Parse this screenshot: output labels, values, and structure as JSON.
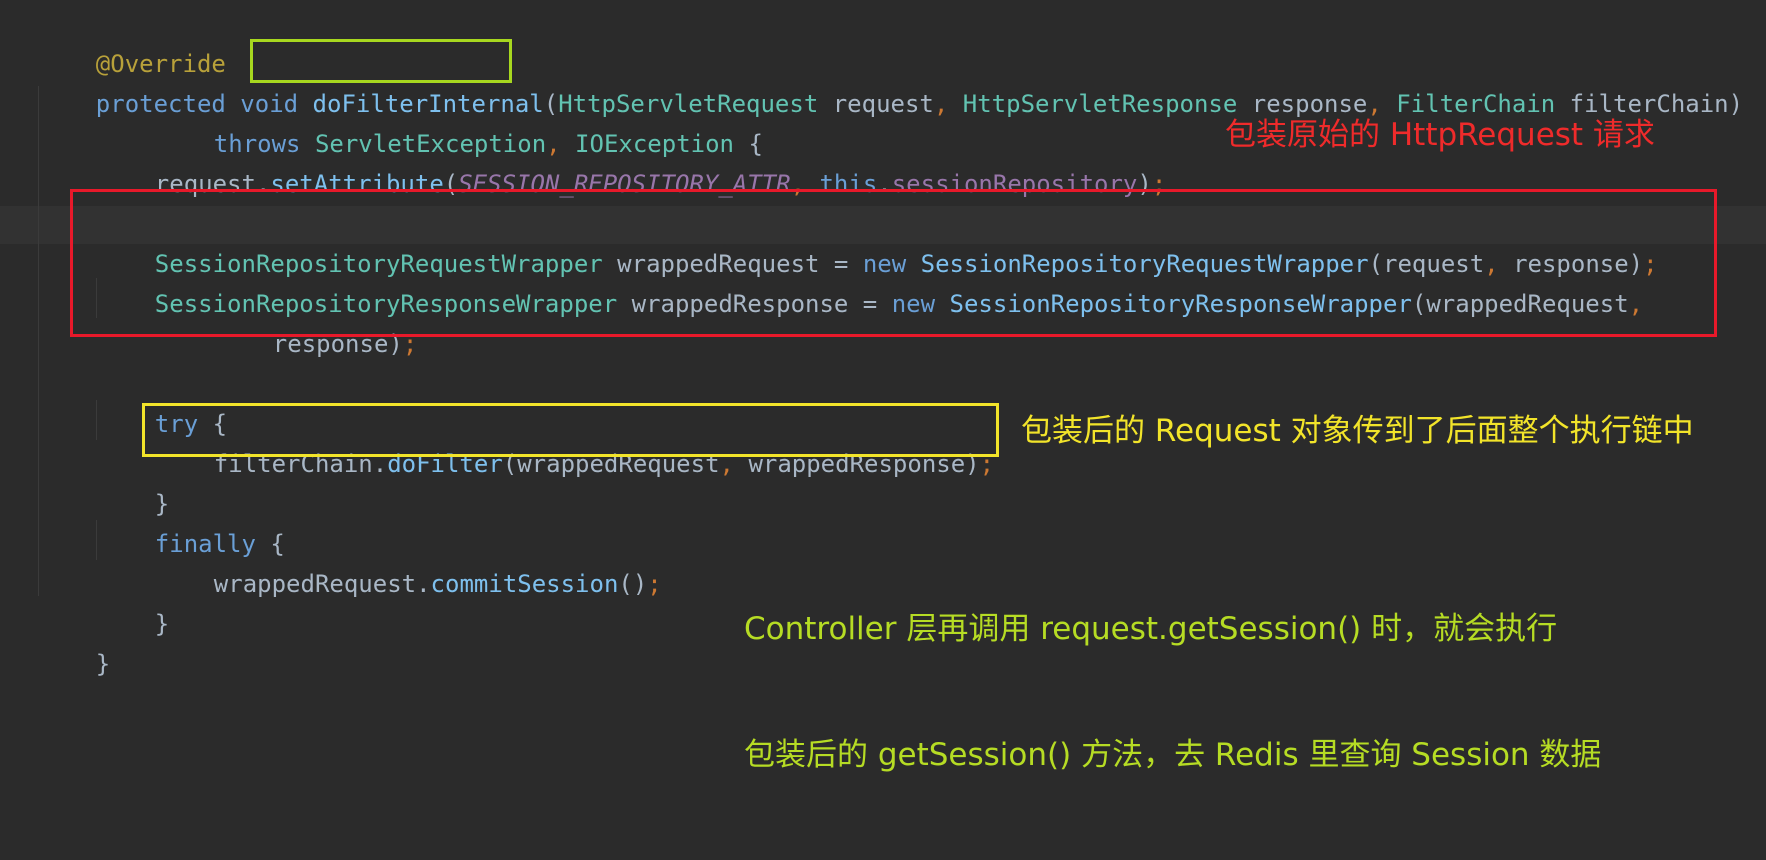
{
  "colors": {
    "background": "#2b2b2b",
    "keyword": "#6a9fd6",
    "type": "#62c3b2",
    "annotation": "#b8a13a",
    "highlight_method": "#a7d71f",
    "highlight_wrap": "#e8192a",
    "highlight_filter": "#f2e42a",
    "note_red": "#ef2b2b",
    "note_yellow": "#f2e42a",
    "note_green": "#b6dc24"
  },
  "code": {
    "l1": {
      "annotation": "@Override"
    },
    "l2": {
      "kw_protected": "protected",
      "kw_void": "void",
      "method": "doFilterInternal",
      "open": "(",
      "t1": "HttpServletRequest",
      "p1": " request",
      "c1": ", ",
      "t2": "HttpServletResponse",
      "p2": " response",
      "c2": ", ",
      "t3": "FilterChain",
      "p3": " filterChain)"
    },
    "l3": {
      "kw_throws": "throws",
      "t1": "ServletException",
      "c1": ", ",
      "t2": "IOException",
      "brace": " {"
    },
    "l4": {
      "obj": "request.",
      "fn": "setAttribute",
      "open": "(",
      "const": "SESSION_REPOSITORY_ATTR",
      "c1": ", ",
      "kw_this": "this",
      "dot": ".",
      "field": "sessionRepository",
      "close": ")",
      "semi": ";"
    },
    "l5": {
      "type": "SessionRepositoryRequestWrapper",
      "var": " wrappedRequest = ",
      "kw_new": "new",
      "ctor": "SessionRepositoryRequestWrapper",
      "args1": "(request",
      "c1": ", ",
      "args2": "response)",
      "semi": ";"
    },
    "l6": {
      "type": "SessionRepositoryResponseWrapper",
      "var": " wrappedResponse = ",
      "kw_new": "new",
      "ctor": "SessionRepositoryResponseWrapper",
      "args1": "(wrappedRequest",
      "c1": ","
    },
    "l7": {
      "args": "response)",
      "semi": ";"
    },
    "l8": {
      "kw_try": "try",
      "brace": " {"
    },
    "l9": {
      "obj": "filterChain.",
      "fn": "doFilter",
      "args1": "(wrappedRequest",
      "c1": ", ",
      "args2": "wrappedResponse)",
      "semi": ";"
    },
    "l10": {
      "brace": "}"
    },
    "l11": {
      "kw_finally": "finally",
      "brace": " {"
    },
    "l12": {
      "obj": "wrappedRequest.",
      "fn": "commitSession",
      "args": "()",
      "semi": ";"
    },
    "l13": {
      "brace": "}"
    },
    "l14": {
      "brace": "}"
    }
  },
  "annotations": {
    "wrap_note": "包装原始的 HttpRequest 请求",
    "filter_note": "包装后的 Request 对象传到了后面整个执行链中",
    "session_note_line1": "Controller 层再调用 request.getSession() 时，就会执行",
    "session_note_line2": "包装后的 getSession() 方法，去 Redis 里查询 Session 数据"
  }
}
